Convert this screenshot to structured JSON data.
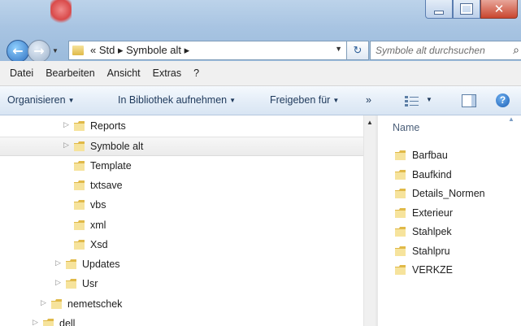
{
  "window": {
    "controls": {
      "minimize": "minimize-icon",
      "maximize": "maximize-icon",
      "close": "close-icon"
    }
  },
  "address": {
    "text": "« Std ▸ Symbole alt ▸",
    "search_placeholder": "Symbole alt durchsuchen"
  },
  "menu": [
    "Datei",
    "Bearbeiten",
    "Ansicht",
    "Extras",
    "?"
  ],
  "commands": {
    "organize": "Organisieren",
    "library": "In Bibliothek aufnehmen",
    "share": "Freigeben für",
    "more": "»"
  },
  "tree": [
    {
      "label": "Reports",
      "indent": 4,
      "expander": "▷",
      "selected": false
    },
    {
      "label": "Symbole alt",
      "indent": 4,
      "expander": "▷",
      "selected": true
    },
    {
      "label": "Template",
      "indent": 4,
      "expander": "",
      "selected": false
    },
    {
      "label": "txtsave",
      "indent": 4,
      "expander": "",
      "selected": false
    },
    {
      "label": "vbs",
      "indent": 4,
      "expander": "",
      "selected": false
    },
    {
      "label": "xml",
      "indent": 4,
      "expander": "",
      "selected": false
    },
    {
      "label": "Xsd",
      "indent": 4,
      "expander": "",
      "selected": false
    },
    {
      "label": "Updates",
      "indent": 3,
      "expander": "▷",
      "selected": false
    },
    {
      "label": "Usr",
      "indent": 3,
      "expander": "▷",
      "selected": false
    },
    {
      "label": "nemetschek",
      "indent": 2,
      "expander": "▷",
      "selected": false
    },
    {
      "label": "dell",
      "indent": 1,
      "expander": "▷",
      "selected": false
    }
  ],
  "content": {
    "column_name": "Name",
    "items": [
      "Barfbau",
      "Baufkind",
      "Details_Normen",
      "Exterieur",
      "Stahlpek",
      "Stahlpru",
      "VERKZE"
    ]
  },
  "colors": {
    "folder_light": "#f6e39c",
    "folder_dark": "#e0b948",
    "selection": "#ebebeb",
    "command_text": "#1e395b"
  }
}
